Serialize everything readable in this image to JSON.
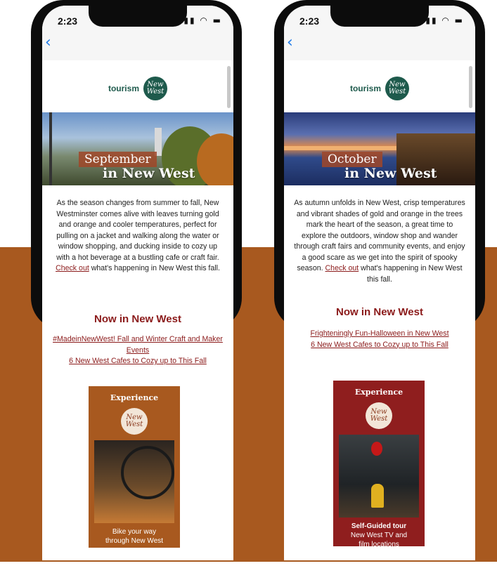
{
  "colors": {
    "brand_green": "#1e5a4c",
    "accent_red": "#8b1a1a",
    "band_orange": "#a8591f",
    "card_orange": "#a8591f",
    "card_red": "#8f1e1e",
    "ios_blue": "#1e7ae8"
  },
  "left": {
    "status_time": "2:23",
    "back_icon": "chevron-left-icon",
    "logo_text": "tourism",
    "logo_circle": "New West",
    "hero_month": "September",
    "hero_inwest": "in New West",
    "intro": "As the season changes from summer to fall, New Westminster comes alive with leaves turning gold and orange and cooler temperatures, perfect for pulling on a jacket and walking along the water or window shopping, and ducking inside to cozy up with a hot beverage at a bustling cafe or craft fair.",
    "cta_link": "Check out",
    "cta_rest": " what's happening in New West this fall.",
    "section_title": "Now in New West",
    "links": [
      "#MadeinNewWest! Fall and Winter Craft and Maker Events",
      "6 New West Cafes to Cozy up to This Fall"
    ],
    "card": {
      "title": "Experience",
      "logo": "New West",
      "caption_line1": "Bike your way",
      "caption_line2": "through New West"
    }
  },
  "right": {
    "status_time": "2:23",
    "back_icon": "chevron-left-icon",
    "logo_text": "tourism",
    "logo_circle": "New West",
    "hero_month": "October",
    "hero_inwest": "in New West",
    "intro_pre": "As autumn unfolds in New West, crisp temperatures and vibrant shades of gold and orange in the trees mark the heart of the season, a great time to explore the outdoors,  window shop and wander through craft fairs and community events, and enjoy a good scare as we get into the spirit of spooky season. ",
    "cta_link": "Check out",
    "cta_rest": " what's happening in New West this fall.",
    "section_title": "Now in New West",
    "links": [
      "Frighteningly Fun-Halloween in New West",
      "6 New West Cafes to Cozy up to This Fall"
    ],
    "card": {
      "title": "Experience",
      "logo": "New West",
      "caption_bold": "Self-Guided tour",
      "caption_line2": "New West TV and",
      "caption_line3": "film locations"
    }
  }
}
